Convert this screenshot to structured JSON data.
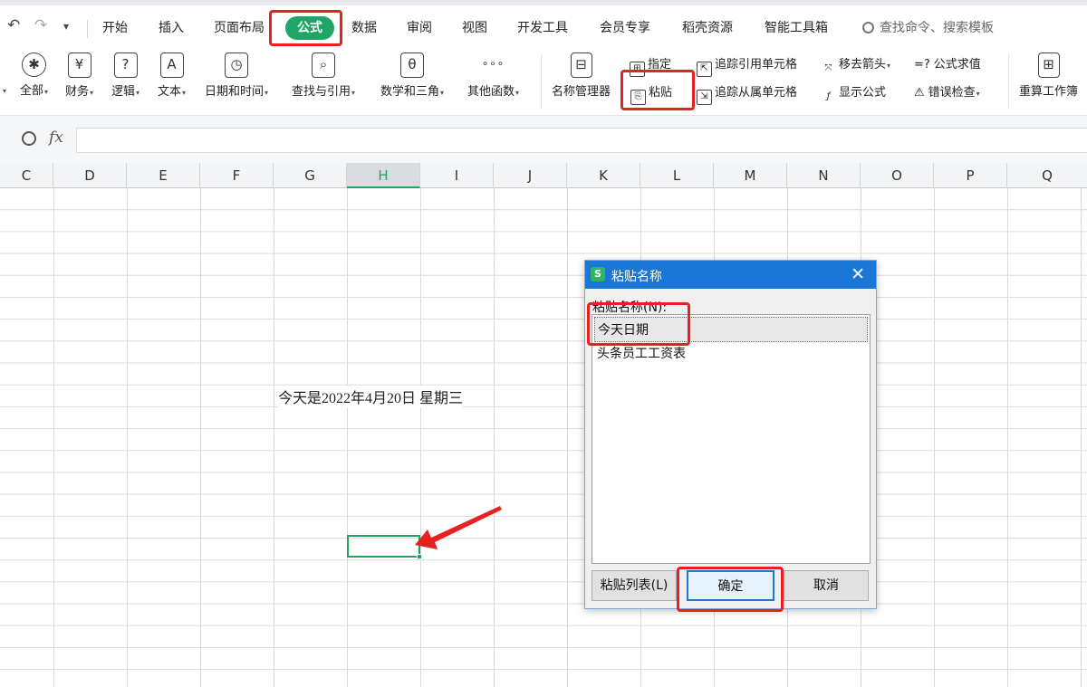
{
  "menubar": {
    "tabs": [
      "开始",
      "插入",
      "页面布局",
      "公式",
      "数据",
      "审阅",
      "视图",
      "开发工具",
      "会员专享",
      "稻壳资源",
      "智能工具箱"
    ],
    "active_tab": "公式",
    "search_placeholder": "查找命令、搜索模板"
  },
  "ribbon": {
    "function_buttons": [
      {
        "label": "全部",
        "icon": "asterisk-icon",
        "glyph": "✱"
      },
      {
        "label": "财务",
        "icon": "yen-icon",
        "glyph": "¥"
      },
      {
        "label": "逻辑",
        "icon": "question-icon",
        "glyph": "?"
      },
      {
        "label": "文本",
        "icon": "text-a-icon",
        "glyph": "A"
      },
      {
        "label": "日期和时间",
        "icon": "clock-icon",
        "glyph": "◷"
      },
      {
        "label": "查找与引用",
        "icon": "magnifier-icon",
        "glyph": "⌕"
      },
      {
        "label": "数学和三角",
        "icon": "theta-icon",
        "glyph": "θ"
      },
      {
        "label": "其他函数",
        "icon": "more-icon",
        "glyph": "∘∘∘"
      }
    ],
    "name_manager": "名称管理器",
    "specify": "指定",
    "paste": "粘贴",
    "trace_precedents": "追踪引用单元格",
    "trace_dependents": "追踪从属单元格",
    "remove_arrows": "移去箭头",
    "show_formulas": "显示公式",
    "evaluate_formula": "公式求值",
    "error_check": "错误检查",
    "recalc": "重算工作簿"
  },
  "formula_bar": {
    "fx": "fx",
    "value": ""
  },
  "sheet": {
    "columns": [
      "C",
      "D",
      "E",
      "F",
      "G",
      "H",
      "I",
      "J",
      "K",
      "L",
      "M",
      "N",
      "O",
      "P",
      "Q"
    ],
    "selected_column": "H",
    "cell_text": "今天是2022年4月20日  星期三"
  },
  "dialog": {
    "title": "粘贴名称",
    "app_icon_letter": "S",
    "close": "✕",
    "list_label": "粘贴名称(N):",
    "items": [
      "今天日期",
      "头条员工工资表"
    ],
    "selected_item": "今天日期",
    "buttons": {
      "paste_list": "粘贴列表(L)",
      "ok": "确定",
      "cancel": "取消"
    }
  },
  "colors": {
    "accent_green": "#1fa565",
    "title_blue": "#1a77d6",
    "highlight_red": "#e8201f"
  }
}
